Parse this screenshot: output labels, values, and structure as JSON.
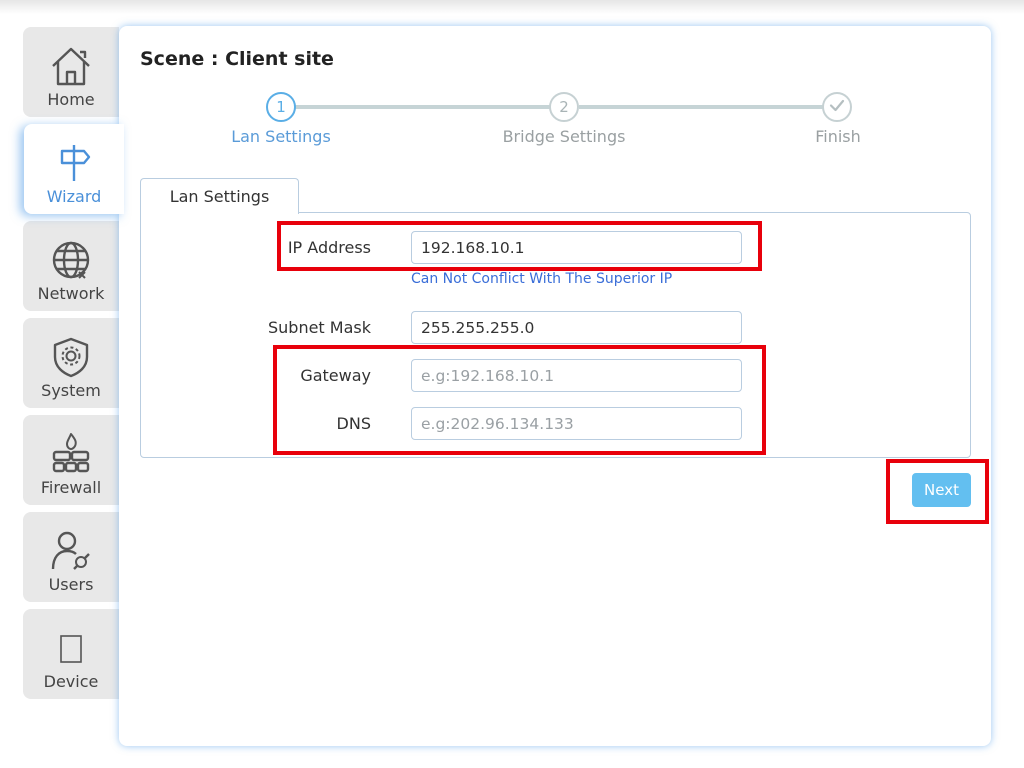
{
  "sidebar": {
    "items": [
      {
        "label": "Home",
        "icon": "home-icon"
      },
      {
        "label": "Wizard",
        "icon": "signpost-icon"
      },
      {
        "label": "Network",
        "icon": "globe-icon"
      },
      {
        "label": "System",
        "icon": "shield-gear-icon"
      },
      {
        "label": "Firewall",
        "icon": "firewall-icon"
      },
      {
        "label": "Users",
        "icon": "user-wrench-icon"
      },
      {
        "label": "Device",
        "icon": "device-icon"
      }
    ],
    "active": "Wizard"
  },
  "scene": {
    "title": "Scene : Client site"
  },
  "stepper": {
    "steps": [
      {
        "number": "1",
        "label": "Lan Settings",
        "state": "active"
      },
      {
        "number": "2",
        "label": "Bridge Settings",
        "state": "pending"
      },
      {
        "number": "✓",
        "label": "Finish",
        "state": "pending"
      }
    ]
  },
  "tab": {
    "label": "Lan Settings"
  },
  "form": {
    "ip_address": {
      "label": "IP Address",
      "value": "192.168.10.1",
      "hint": "Can Not Conflict With The Superior IP"
    },
    "subnet_mask": {
      "label": "Subnet Mask",
      "value": "255.255.255.0"
    },
    "gateway": {
      "label": "Gateway",
      "value": "",
      "placeholder": "e.g:192.168.10.1"
    },
    "dns": {
      "label": "DNS",
      "value": "",
      "placeholder": "e.g:202.96.134.133"
    }
  },
  "actions": {
    "next_label": "Next"
  },
  "colors": {
    "accent": "#5aaee6",
    "button": "#63bff0",
    "hint": "#3a6ed8",
    "highlight": "#e8000b",
    "sidebar_bg": "#e8e8e8"
  }
}
